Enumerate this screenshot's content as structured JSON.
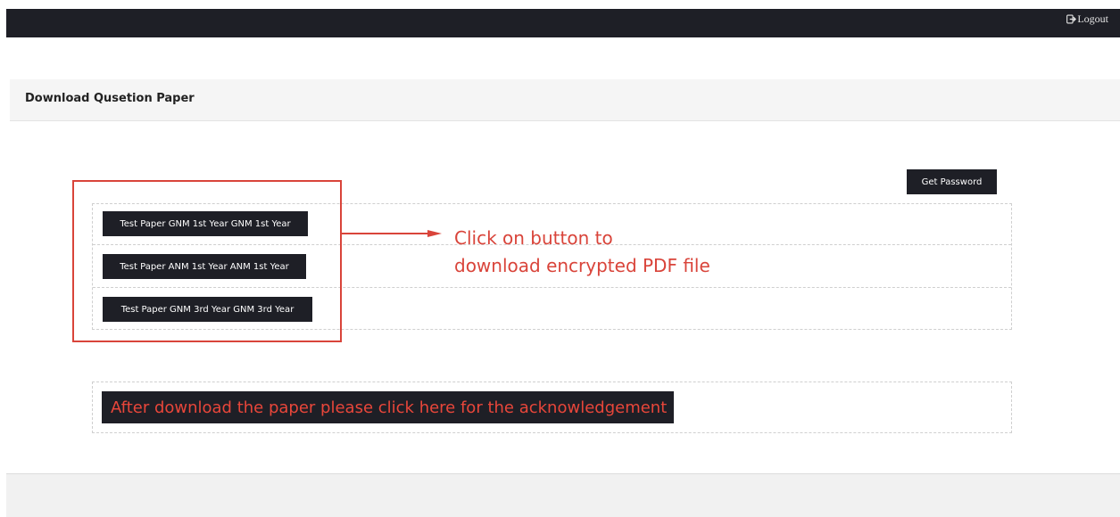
{
  "topbar": {
    "logout_label": "Logout",
    "logout_icon": "logout-icon"
  },
  "panel": {
    "title": "Download Qusetion Paper"
  },
  "actions": {
    "get_password_label": "Get Password"
  },
  "papers": [
    {
      "label": "Test Paper GNM 1st Year GNM 1st Year"
    },
    {
      "label": "Test Paper ANM 1st Year ANM 1st Year"
    },
    {
      "label": "Test Paper GNM 3rd Year GNM 3rd Year"
    }
  ],
  "annotation": {
    "line1": "Click on button to",
    "line2": "download encrypted PDF file",
    "color": "#d9443a"
  },
  "acknowledgement": {
    "label": "After download the paper please click here for the acknowledgement"
  },
  "colors": {
    "dark": "#1e1f26",
    "annotation_red": "#d9443a"
  }
}
